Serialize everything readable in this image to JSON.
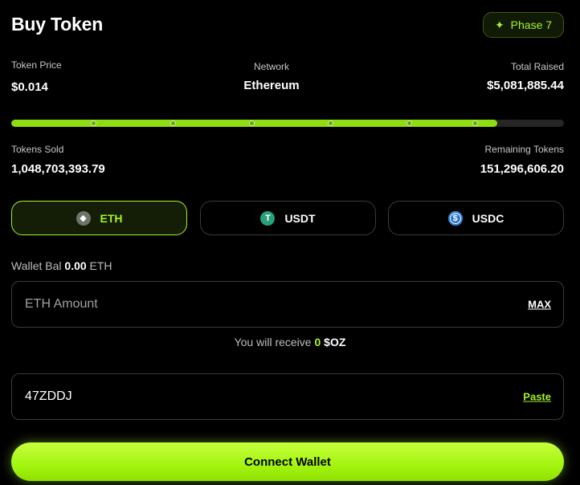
{
  "header": {
    "title": "Buy Token",
    "phase_label": "Phase 7",
    "phase_icon": "sparkle-icon"
  },
  "stats": {
    "token_price_label": "Token Price",
    "token_price_value": "$0.014",
    "network_label": "Network",
    "network_value": "Ethereum",
    "total_raised_label": "Total Raised",
    "total_raised_value": "$5,081,885.44",
    "tokens_sold_label": "Tokens Sold",
    "tokens_sold_value": "1,048,703,393.79",
    "remaining_label": "Remaining Tokens",
    "remaining_value": "151,296,606.20"
  },
  "progress": {
    "fraction": 0.879,
    "phase_markers": 6
  },
  "currencies": [
    {
      "label": "ETH",
      "icon": "ethereum-icon",
      "active": true
    },
    {
      "label": "USDT",
      "icon": "tether-icon",
      "active": false
    },
    {
      "label": "USDC",
      "icon": "usdc-icon",
      "active": false
    }
  ],
  "wallet": {
    "label": "Wallet Bal",
    "amount": "0.00",
    "unit": "ETH"
  },
  "amount_input": {
    "placeholder": "ETH Amount",
    "value": "",
    "max_label": "MAX"
  },
  "receive": {
    "prefix": "You will receive",
    "amount": "0",
    "symbol": "$OZ"
  },
  "referral_input": {
    "value": "47ZDDJ",
    "paste_label": "Paste"
  },
  "connect_button": {
    "label": "Connect Wallet"
  },
  "colors": {
    "accent": "#a6f22c",
    "background": "#000000",
    "border": "#3a3a3a"
  }
}
